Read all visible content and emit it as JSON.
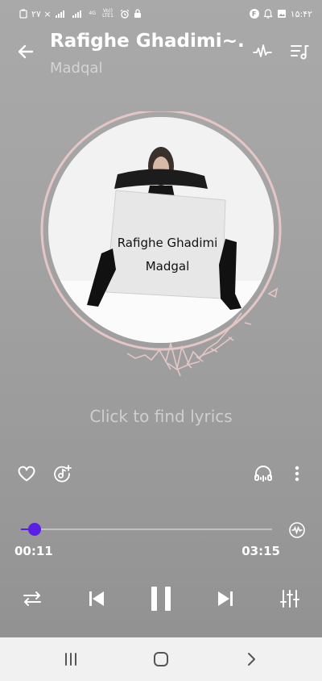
{
  "status_bar": {
    "left_text": "۲۷ ×",
    "net1": "4G",
    "net2": "Vo)) LTE1",
    "f_badge": "F",
    "time": "۱۵:۴۲"
  },
  "header": {
    "title": "Rafighe Ghadimi~...",
    "artist": "Madqal"
  },
  "album_art": {
    "line1": "Rafighe Ghadimi",
    "line2": "Madgal"
  },
  "lyrics": {
    "prompt": "Click to find lyrics"
  },
  "player": {
    "current_time": "00:11",
    "total_time": "03:15",
    "progress_fraction": 0.056,
    "state": "playing"
  },
  "colors": {
    "accent": "#5b1ee6",
    "ring": "#e8c4c4"
  },
  "icons": {
    "back": "arrow-left-icon",
    "waveform": "waveform-icon",
    "playlist": "playlist-icon",
    "like": "heart-icon",
    "add_to_playlist": "music-note-add-icon",
    "headphones": "headphones-icon",
    "more": "more-vertical-icon",
    "audio_effect": "audio-effect-icon",
    "repeat": "repeat-icon",
    "previous": "skip-previous-icon",
    "pause": "pause-icon",
    "next": "skip-next-icon",
    "equalizer": "equalizer-icon",
    "nav_recents": "recents-icon",
    "nav_home": "home-icon",
    "nav_back": "nav-back-icon"
  }
}
